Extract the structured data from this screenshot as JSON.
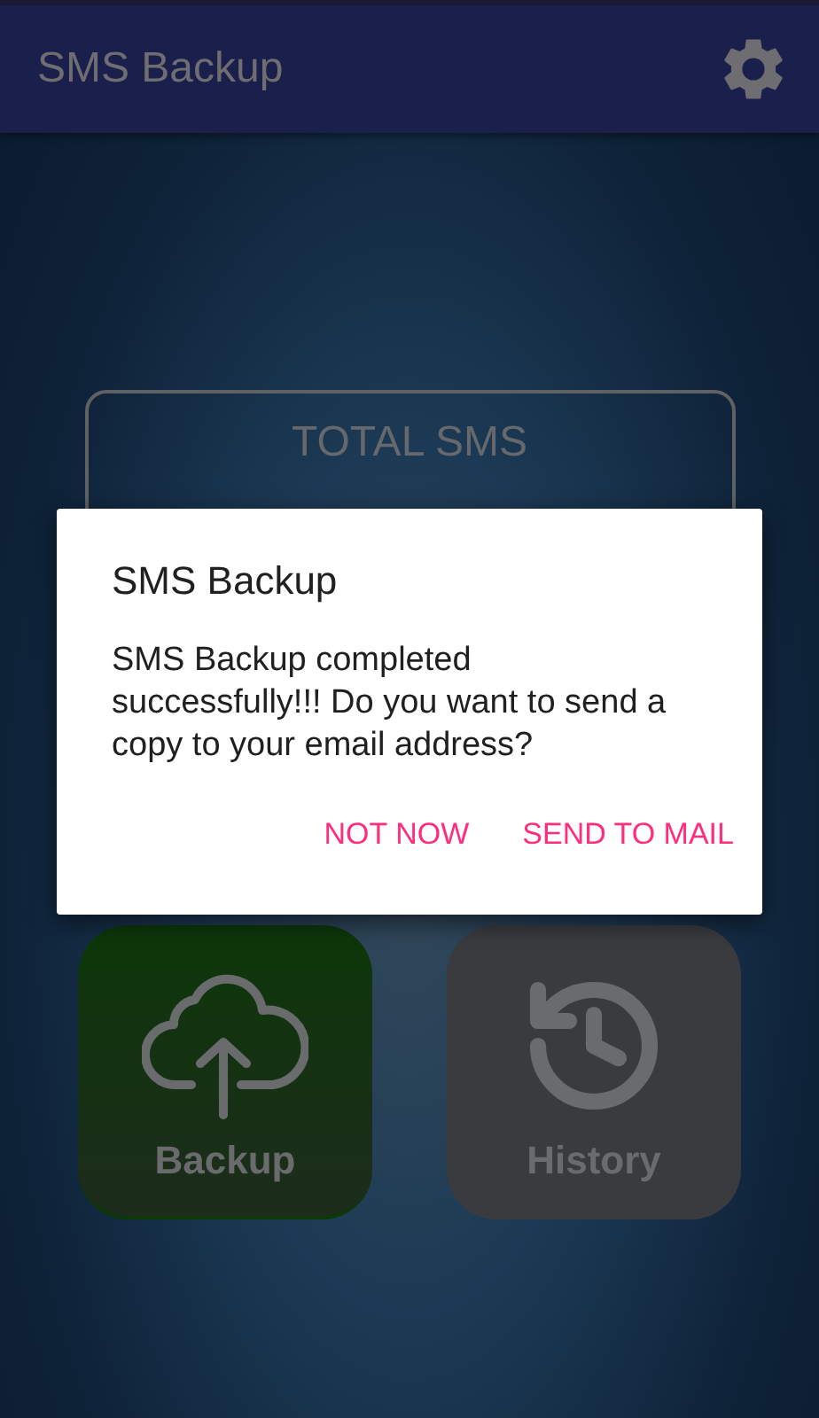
{
  "app_bar": {
    "title": "SMS Backup"
  },
  "summary_card": {
    "label": "TOTAL SMS"
  },
  "actions": [
    {
      "kind": "backup",
      "label": "Backup"
    },
    {
      "kind": "history",
      "label": "History"
    }
  ],
  "dialog": {
    "title": "SMS Backup",
    "message": "SMS Backup completed successfully!!! Do you want to send a copy to your email address?",
    "buttons": [
      "NOT NOW",
      "SEND TO MAIL"
    ]
  }
}
